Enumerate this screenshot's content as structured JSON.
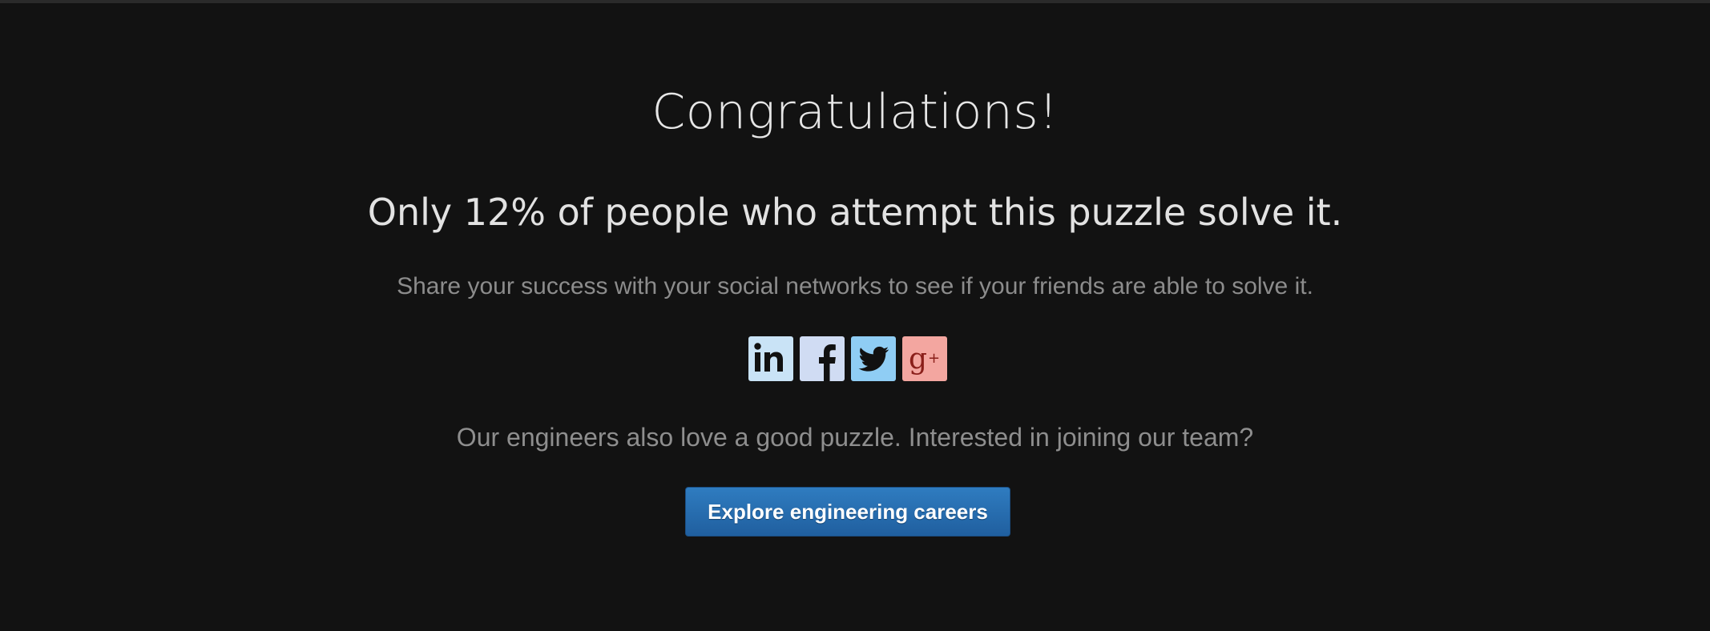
{
  "heading": "Congratulations!",
  "stat_line": "Only 12% of people who attempt this puzzle solve it.",
  "share_text": "Share your success with your social networks to see if your friends are able to solve it.",
  "social": [
    {
      "name": "LinkedIn",
      "icon": "linkedin-icon",
      "color": "#c9e3f6"
    },
    {
      "name": "Facebook",
      "icon": "facebook-icon",
      "color": "#d0dcf3"
    },
    {
      "name": "Twitter",
      "icon": "twitter-icon",
      "color": "#8fcdf4"
    },
    {
      "name": "Google+",
      "icon": "google-plus-icon",
      "color": "#f3a6a0"
    }
  ],
  "careers_text": "Our engineers also love a good puzzle. Interested in joining our team?",
  "cta_label": "Explore engineering careers",
  "colors": {
    "background": "#121212",
    "button": "#2f7cc0"
  }
}
